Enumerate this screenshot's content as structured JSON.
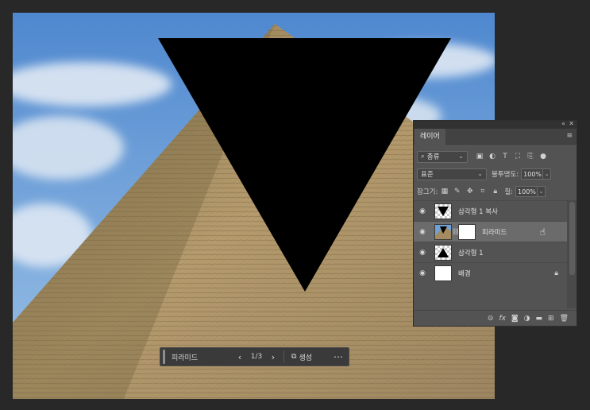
{
  "panel": {
    "tab": "레이어",
    "collapse_icon": "«",
    "close_icon": "✕",
    "menu_icon": "≡",
    "filter": {
      "icon": "search-icon",
      "value": "종류"
    },
    "filter_icons": [
      "image-icon",
      "adjustment-icon",
      "type-icon",
      "shape-icon",
      "smart-object-icon",
      "dot-toggle-icon"
    ],
    "blend_mode": "표준",
    "opacity_label": "불투명도:",
    "opacity_value": "100%",
    "lock_label": "잠그기:",
    "lock_icons": [
      "lock-pixels-icon",
      "lock-brush-icon",
      "lock-move-icon",
      "lock-artboard-icon",
      "lock-all-icon"
    ],
    "fill_label": "칠:",
    "fill_value": "100%",
    "layers": [
      {
        "name": "삼각형 1 복사",
        "type": "shape-copy"
      },
      {
        "name": "피라미드",
        "type": "image",
        "active": true
      },
      {
        "name": "삼각형 1",
        "type": "shape"
      },
      {
        "name": "배경",
        "type": "background",
        "locked": true
      }
    ],
    "bottom_icons": [
      "link-icon",
      "fx-icon",
      "mask-icon",
      "adjustment-layer-icon",
      "group-folder-icon",
      "new-layer-icon",
      "trash-icon"
    ]
  },
  "taskbar": {
    "name": "피라미드",
    "page": "1/3",
    "generate_label": "생성",
    "more": "⋯"
  },
  "colors": {
    "background": "#282828",
    "panel": "#535353",
    "sky": "#6fa2d8",
    "triangle": "#000000"
  }
}
